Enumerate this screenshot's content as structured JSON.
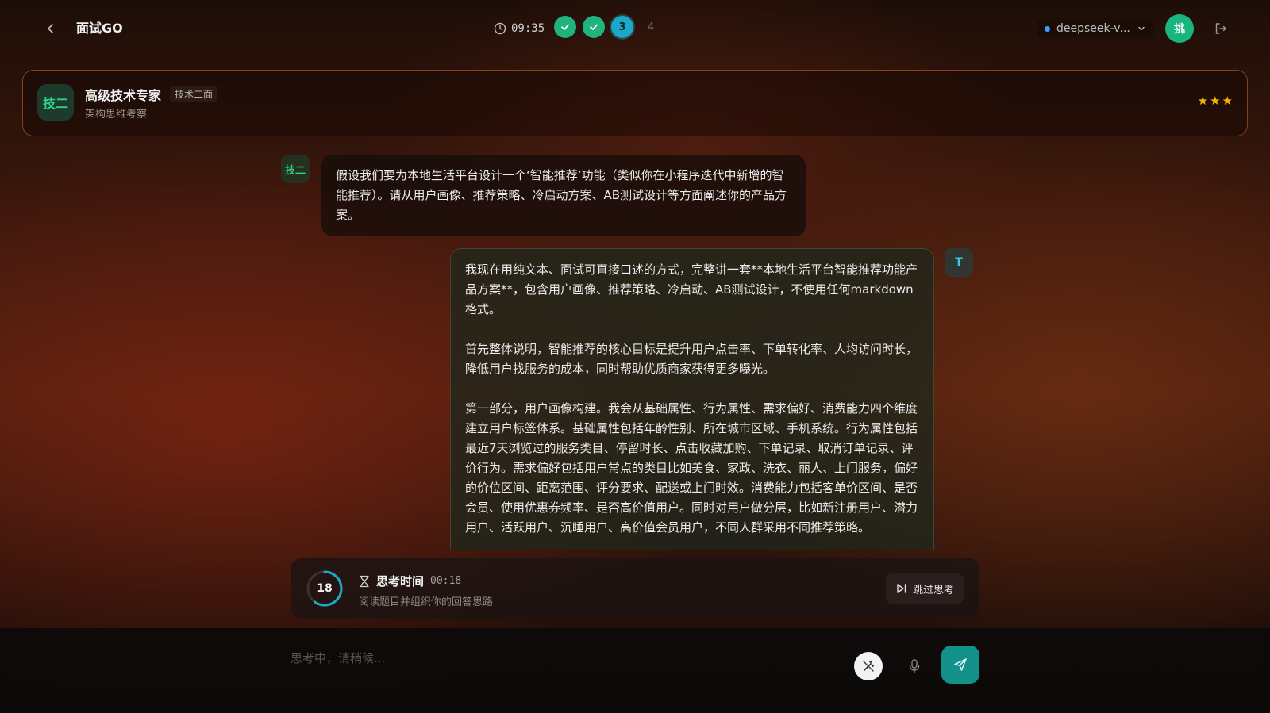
{
  "header": {
    "app_title": "面试GO",
    "timer": "09:35",
    "steps": [
      {
        "label": "",
        "state": "done"
      },
      {
        "label": "",
        "state": "done"
      },
      {
        "label": "3",
        "state": "current"
      },
      {
        "label": "4",
        "state": "pending"
      }
    ],
    "model": "deepseek-v...",
    "user_avatar": "挑"
  },
  "interviewer": {
    "avatar": "技二",
    "name": "高级技术专家",
    "tag": "技术二面",
    "subtitle": "架构思维考察",
    "stars": [
      "★",
      "★",
      "★"
    ]
  },
  "chat": {
    "ai_avatar": "技二",
    "question": "假设我们要为本地生活平台设计一个‘智能推荐’功能（类似你在小程序迭代中新增的智能推荐）。请从用户画像、推荐策略、冷启动方案、AB测试设计等方面阐述你的产品方案。",
    "user_avatar": "T",
    "answer_paragraphs": [
      "我现在用纯文本、面试可直接口述的方式，完整讲一套**本地生活平台智能推荐功能产品方案**，包含用户画像、推荐策略、冷启动、AB测试设计，不使用任何markdown格式。",
      "首先整体说明，智能推荐的核心目标是提升用户点击率、下单转化率、人均访问时长，降低用户找服务的成本，同时帮助优质商家获得更多曝光。",
      "第一部分，用户画像构建。我会从基础属性、行为属性、需求偏好、消费能力四个维度建立用户标签体系。基础属性包括年龄性别、所在城市区域、手机系统。行为属性包括最近7天浏览过的服务类目、停留时长、点击收藏加购、下单记录、取消订单记录、评价行为。需求偏好包括用户常点的类目比如美食、家政、洗衣、丽人、上门服务，偏好的价位区间、距离范围、评分要求、配送或上门时效。消费能力包括客单价区间、是否会员、使用优惠券频率、是否高价值用户。同时对用户做分层，比如新注册用户、潜力用户、活跃用户、沉睡用户、高价值会员用户，不同人群采用不同推荐策略。"
    ]
  },
  "thinking": {
    "count": "18",
    "progress": 0.6,
    "title": "思考时间",
    "time": "00:18",
    "subtitle": "阅读题目并组织你的回答思路",
    "skip_label": "跳过思考"
  },
  "input": {
    "placeholder": "思考中，请稍候..."
  },
  "colors": {
    "accent_green": "#1fb37d",
    "accent_cyan": "#1ba8c9",
    "send_button": "#12918a",
    "star": "#f5b400"
  }
}
